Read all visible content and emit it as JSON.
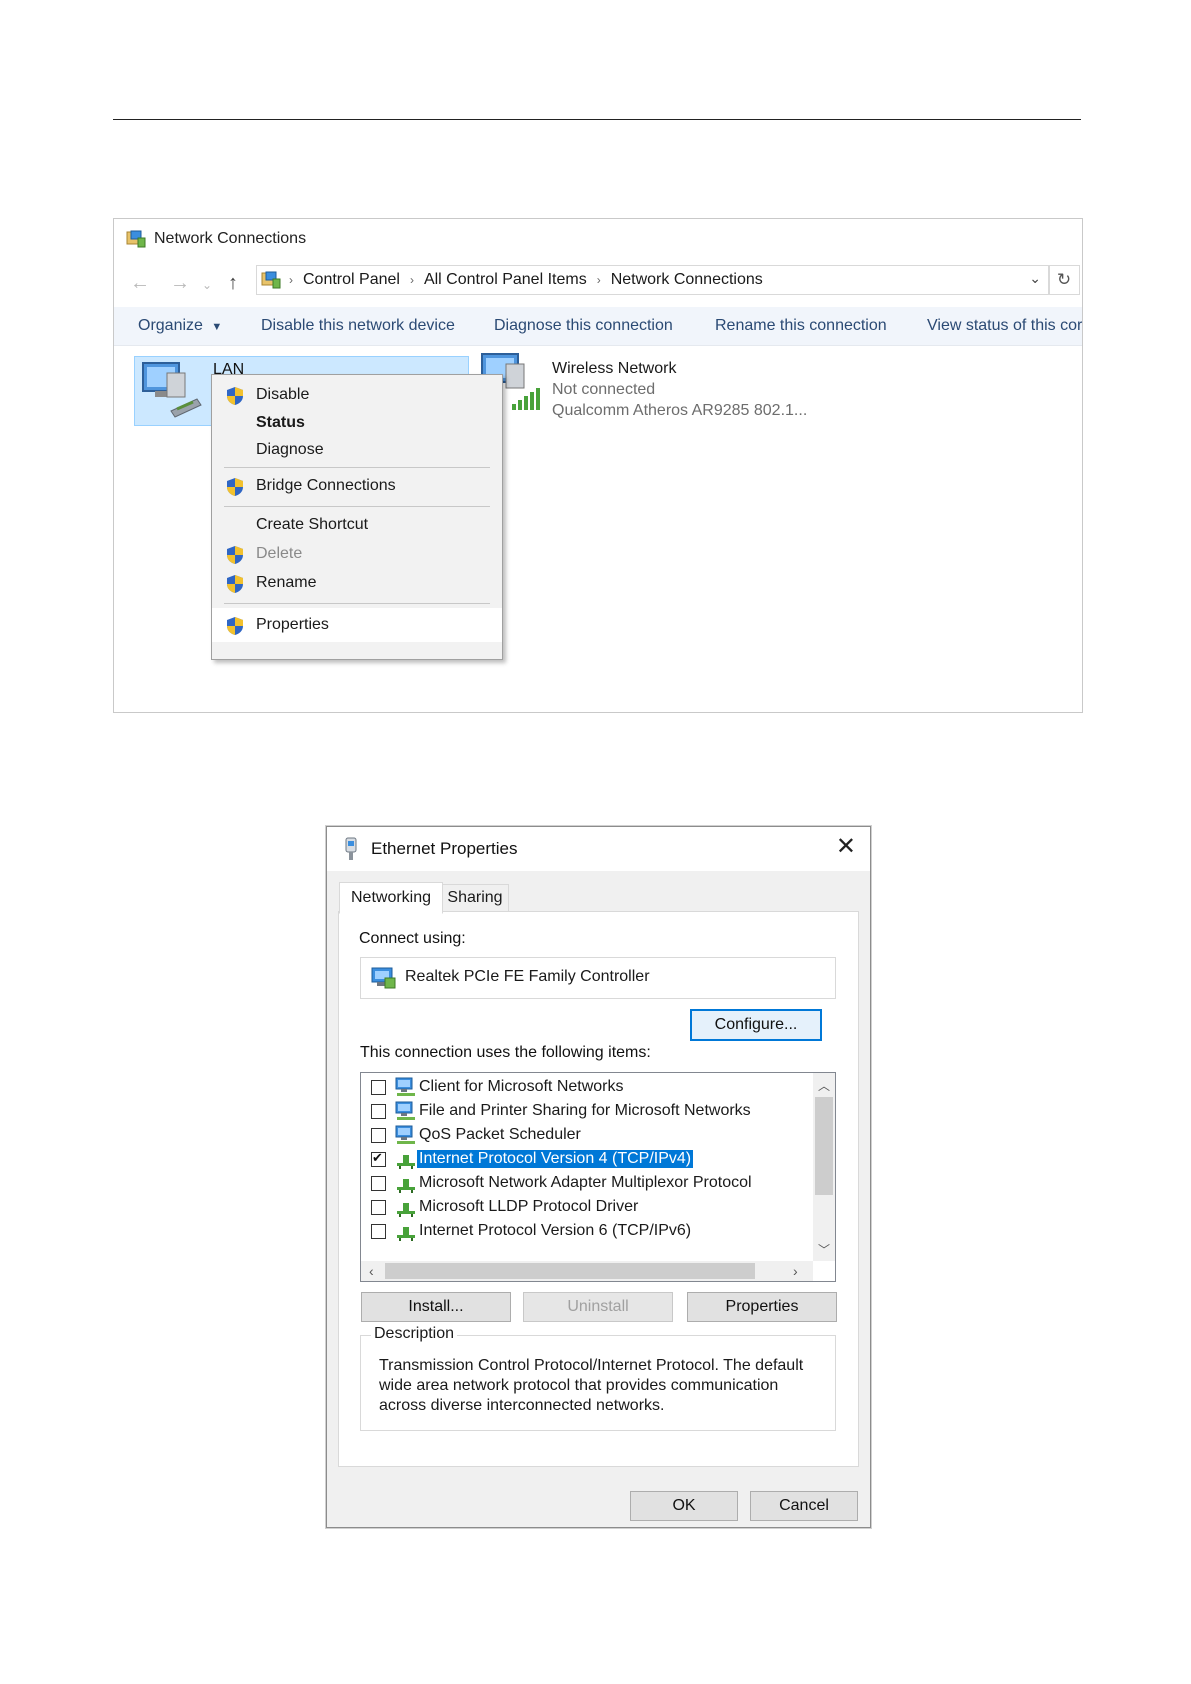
{
  "network_connections": {
    "title": "Network Connections",
    "breadcrumb": [
      "Control Panel",
      "All Control Panel Items",
      "Network Connections"
    ],
    "commands": [
      "Organize",
      "Disable this network device",
      "Diagnose this connection",
      "Rename this connection",
      "View status of this cor"
    ],
    "lan": {
      "name": "LAN"
    },
    "wireless": {
      "name": "Wireless Network",
      "status": "Not connected",
      "adapter": "Qualcomm Atheros AR9285 802.1..."
    },
    "context_menu": {
      "disable": "Disable",
      "status": "Status",
      "diagnose": "Diagnose",
      "bridge": "Bridge Connections",
      "shortcut": "Create Shortcut",
      "delete": "Delete",
      "rename": "Rename",
      "properties": "Properties"
    }
  },
  "ethernet_properties": {
    "title": "Ethernet Properties",
    "tabs": [
      "Networking",
      "Sharing"
    ],
    "connect_using_label": "Connect using:",
    "adapter": "Realtek PCIe FE Family Controller",
    "configure_button": "Configure...",
    "items_label": "This connection uses the following items:",
    "items": [
      {
        "label": "Client for Microsoft Networks",
        "checked": false
      },
      {
        "label": "File and Printer Sharing for Microsoft Networks",
        "checked": false
      },
      {
        "label": "QoS Packet Scheduler",
        "checked": false
      },
      {
        "label": "Internet Protocol Version 4 (TCP/IPv4)",
        "checked": true,
        "selected": true
      },
      {
        "label": "Microsoft Network Adapter Multiplexor Protocol",
        "checked": false
      },
      {
        "label": "Microsoft LLDP Protocol Driver",
        "checked": false
      },
      {
        "label": "Internet Protocol Version 6 (TCP/IPv6)",
        "checked": false
      }
    ],
    "install_button": "Install...",
    "uninstall_button": "Uninstall",
    "properties_button": "Properties",
    "description_label": "Description",
    "description": "Transmission Control Protocol/Internet Protocol. The default wide area network protocol that provides communication across diverse interconnected networks.",
    "ok_button": "OK",
    "cancel_button": "Cancel"
  },
  "colors": {
    "selection": "#0078d7",
    "tile": "#cce8ff",
    "command_text": "#2b4a74"
  }
}
